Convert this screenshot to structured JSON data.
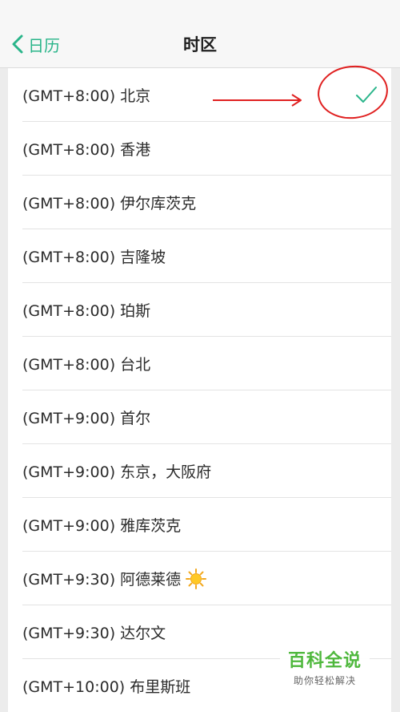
{
  "header": {
    "back_label": "日历",
    "title": "时区"
  },
  "timezones": [
    {
      "label": "(GMT+8:00) 北京",
      "selected": true
    },
    {
      "label": "(GMT+8:00) 香港",
      "selected": false
    },
    {
      "label": "(GMT+8:00) 伊尔库茨克",
      "selected": false
    },
    {
      "label": "(GMT+8:00) 吉隆坡",
      "selected": false
    },
    {
      "label": "(GMT+8:00) 珀斯",
      "selected": false
    },
    {
      "label": "(GMT+8:00) 台北",
      "selected": false
    },
    {
      "label": "(GMT+9:00) 首尔",
      "selected": false
    },
    {
      "label": "(GMT+9:00) 东京，大阪府",
      "selected": false
    },
    {
      "label": "(GMT+9:00) 雅库茨克",
      "selected": false
    },
    {
      "label": "(GMT+9:30) 阿德莱德",
      "selected": false,
      "icon": "sun-icon"
    },
    {
      "label": "(GMT+9:30) 达尔文",
      "selected": false
    },
    {
      "label": "(GMT+10:00) 布里斯班",
      "selected": false
    }
  ],
  "watermark": {
    "main": "百科全说",
    "sub": "助你轻松解决"
  },
  "colors": {
    "accent": "#2ab58a",
    "annotation": "#e02020",
    "watermark_green": "#4fb83d"
  }
}
